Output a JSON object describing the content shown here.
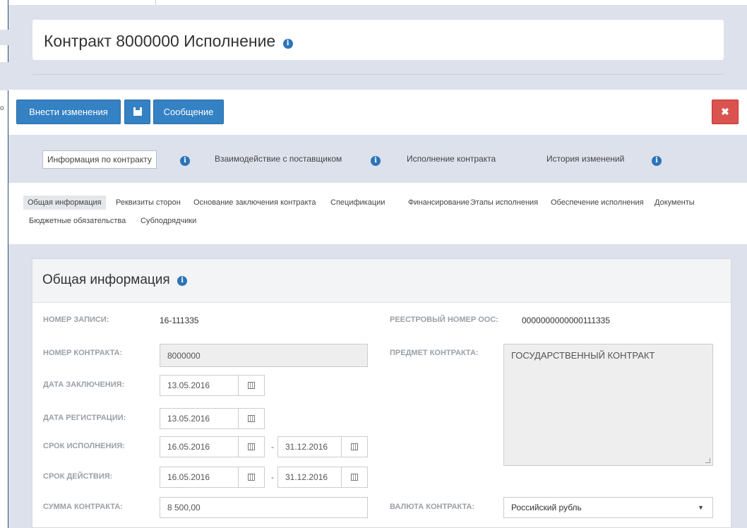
{
  "background": {
    "sliver_char": "о"
  },
  "header": {
    "title": "Контракт 8000000 Исполнение",
    "info_glyph": "i"
  },
  "toolbar": {
    "edit_label": "Внести изменения",
    "message_label": "Сообщение",
    "close_glyph": "✖"
  },
  "main_tabs": [
    {
      "label": "Информация по контракту",
      "active": true
    },
    {
      "label": "Взаимодействие с поставщиком"
    },
    {
      "label": "Исполнение контракта"
    },
    {
      "label": "История изменений"
    }
  ],
  "sub_tabs": [
    {
      "label": "Общая информация",
      "active": true
    },
    {
      "label": "Реквизиты сторон"
    },
    {
      "label": "Основание заключения контракта"
    },
    {
      "label": "Спецификации"
    },
    {
      "label": "Финансирование"
    },
    {
      "label": "Этапы исполнения"
    },
    {
      "label": "Обеспечение исполнения"
    },
    {
      "label": "Документы"
    },
    {
      "label": "Бюджетные обязательства"
    },
    {
      "label": "Субподрядчики"
    }
  ],
  "section": {
    "title": "Общая информация",
    "record_number_label": "НОМЕР ЗАПИСИ:",
    "record_number": "16-111335",
    "registry_number_label": "РЕЕСТРОВЫЙ НОМЕР ООС:",
    "registry_number": "0000000000000111335",
    "contract_number_label": "НОМЕР КОНТРАКТА:",
    "contract_number": "8000000",
    "subject_label": "ПРЕДМЕТ КОНТРАКТА:",
    "subject": "ГОСУДАРСТВЕННЫЙ КОНТРАКТ",
    "conclusion_date_label": "ДАТА ЗАКЛЮЧЕНИЯ:",
    "conclusion_date": "13.05.2016",
    "registration_date_label": "ДАТА РЕГИСТРАЦИИ:",
    "registration_date": "13.05.2016",
    "execution_period_label": "СРОК ИСПОЛНЕНИЯ:",
    "execution_from": "16.05.2016",
    "execution_to": "31.12.2016",
    "validity_period_label": "СРОК ДЕЙСТВИЯ:",
    "validity_from": "16.05.2016",
    "validity_to": "31.12.2016",
    "range_separator": "-",
    "amount_label": "СУММА КОНТРАКТА:",
    "amount": "8 500,00",
    "currency_label": "ВАЛЮТА КОНТРАКТА:",
    "currency": "Российский рубль",
    "currency_caret": "▼"
  },
  "colors": {
    "primary": "#3481c4",
    "danger": "#d9534f",
    "page_bg": "#dde1ec",
    "info_icon": "#2d74b8"
  }
}
